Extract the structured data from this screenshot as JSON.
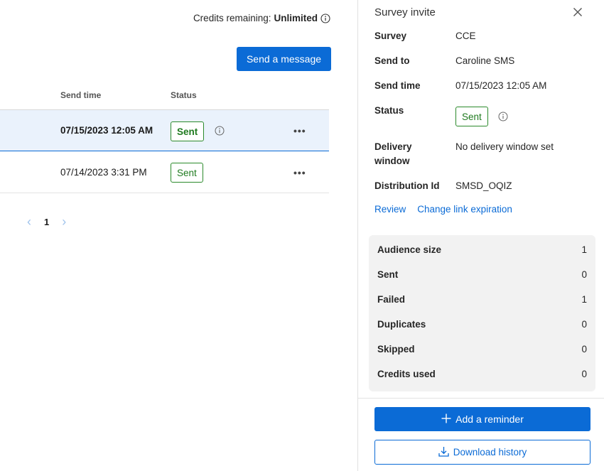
{
  "header": {
    "credits_label": "Credits remaining:",
    "credits_value": "Unlimited",
    "send_button": "Send a message"
  },
  "table": {
    "columns": [
      "Send time",
      "Status"
    ],
    "rows": [
      {
        "send_time": "07/15/2023 12:05 AM",
        "status": "Sent",
        "selected": true
      },
      {
        "send_time": "07/14/2023 3:31 PM",
        "status": "Sent",
        "selected": false
      }
    ],
    "more_label": "•••"
  },
  "pagination": {
    "prev": "‹",
    "page": "1",
    "next": "›"
  },
  "panel": {
    "title": "Survey invite",
    "fields": [
      {
        "label": "Survey",
        "value": "CCE"
      },
      {
        "label": "Send to",
        "value": "Caroline SMS"
      },
      {
        "label": "Send time",
        "value": "07/15/2023 12:05 AM"
      },
      {
        "label": "Status",
        "value": "Sent"
      },
      {
        "label": "Delivery window",
        "value": "No delivery window set"
      },
      {
        "label": "Distribution Id",
        "value": "SMSD_OQIZ"
      }
    ],
    "links": {
      "review": "Review",
      "change_link": "Change link expiration"
    },
    "stats": [
      {
        "label": "Audience size",
        "value": "1"
      },
      {
        "label": "Sent",
        "value": "0"
      },
      {
        "label": "Failed",
        "value": "1"
      },
      {
        "label": "Duplicates",
        "value": "0"
      },
      {
        "label": "Skipped",
        "value": "0"
      },
      {
        "label": "Credits used",
        "value": "0"
      }
    ],
    "reminder_button": "Add a reminder",
    "download_button": "Download history"
  },
  "colors": {
    "accent": "#0b6bd6",
    "success": "#2b8a2b",
    "selected_row": "#eaf2fc",
    "stats_bg": "#f2f2f2"
  },
  "icons": [
    "info-icon",
    "close-icon",
    "plus-icon",
    "download-icon",
    "more-icon",
    "chevron-left-icon",
    "chevron-right-icon"
  ]
}
